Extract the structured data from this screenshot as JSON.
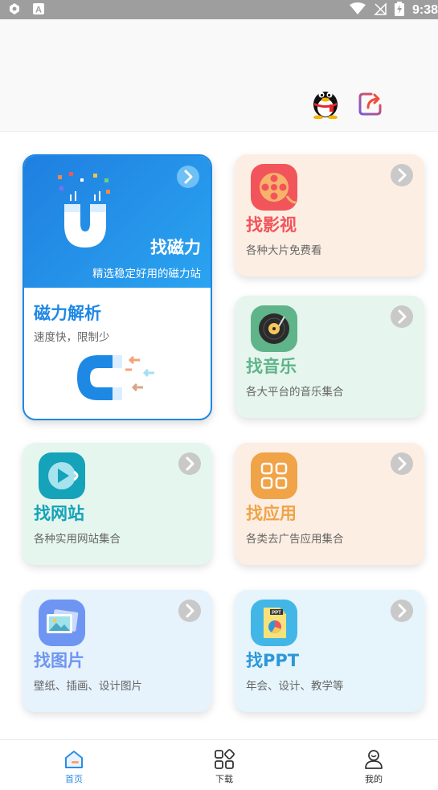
{
  "status_bar": {
    "time": "9:38"
  },
  "header": {
    "qq_icon": "qq-penguin-icon",
    "share_icon": "share-icon"
  },
  "cards": {
    "magnet": {
      "header_title": "找磁力",
      "header_subtitle": "精选稳定好用的磁力站",
      "title": "磁力解析",
      "subtitle": "速度快，限制少"
    },
    "video": {
      "title": "找影视",
      "subtitle": "各种大片免费看",
      "accent": "#f2545b"
    },
    "music": {
      "title": "找音乐",
      "subtitle": "各大平台的音乐集合",
      "accent": "#5fb48a"
    },
    "website": {
      "title": "找网站",
      "subtitle": "各种实用网站集合",
      "accent": "#14a3b8"
    },
    "apps": {
      "title": "找应用",
      "subtitle": "各类去广告应用集合",
      "accent": "#f0a347"
    },
    "images": {
      "title": "找图片",
      "subtitle": "壁纸、插画、设计图片",
      "accent": "#6f95f2"
    },
    "ppt": {
      "title": "找PPT",
      "subtitle": "年会、设计、教学等",
      "accent": "#2c98d8",
      "icon_text": "PPT"
    }
  },
  "bottom_nav": {
    "home": "首页",
    "download": "下载",
    "mine": "我的"
  },
  "colors": {
    "primary": "#1e88e5",
    "nav_active": "#2a8de8"
  }
}
